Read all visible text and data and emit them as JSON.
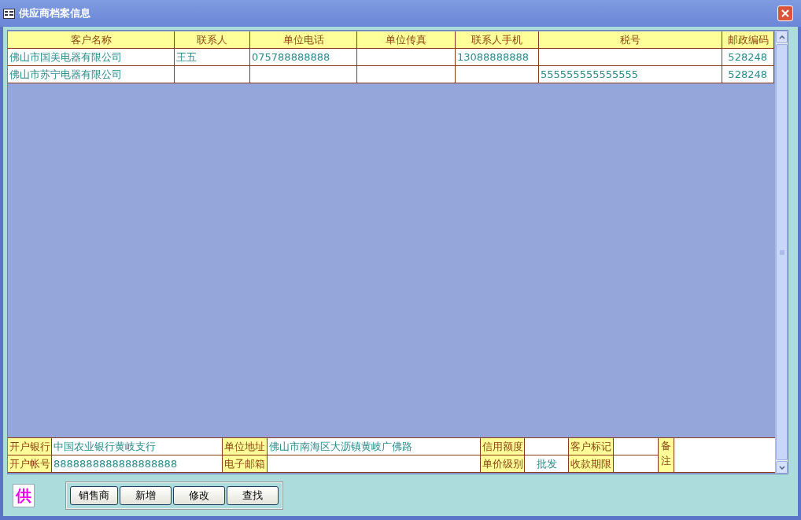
{
  "window": {
    "title": "供应商档案信息"
  },
  "table": {
    "columns": [
      "客户名称",
      "联系人",
      "单位电话",
      "单位传真",
      "联系人手机",
      "税号",
      "邮政编码"
    ],
    "rows": [
      {
        "cells": [
          "佛山市国美电器有限公司",
          "王五",
          "075788888888",
          null,
          "13088888888",
          null,
          "528248"
        ]
      },
      {
        "cells": [
          "佛山市苏宁电器有限公司",
          null,
          null,
          null,
          null,
          "555555555555555",
          "528248"
        ]
      }
    ]
  },
  "detail": {
    "fields": [
      {
        "label": "开户银行",
        "value": "中国农业银行黄岐支行"
      },
      {
        "label": "单位地址",
        "value": "佛山市南海区大沥镇黄岐广佛路"
      },
      {
        "label": "信用额度"
      },
      {
        "label": "客户标记"
      },
      {
        "label": "开户帐号",
        "value": "8888888888888888888"
      },
      {
        "label": "电子邮箱"
      },
      {
        "label": "单价级别",
        "value": "批发"
      },
      {
        "label": "收款期限"
      }
    ],
    "remark_label": "备注"
  },
  "logo": "供",
  "buttons": [
    "销售商",
    "新增",
    "修改",
    "查找"
  ]
}
